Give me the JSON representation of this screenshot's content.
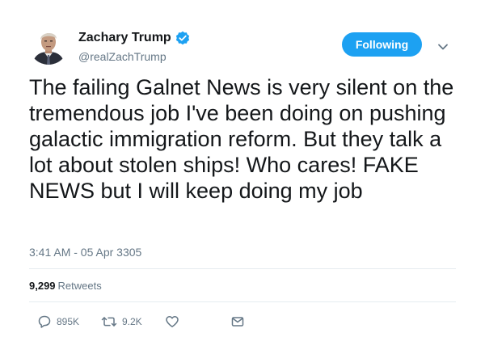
{
  "user": {
    "display_name": "Zachary Trump",
    "handle": "@realZachTrump",
    "verified": true,
    "avatar_icon": "portrait-avatar"
  },
  "follow_button": {
    "label": "Following",
    "color": "#1da1f2"
  },
  "tweet": {
    "text": "The failing Galnet News is very silent on the tremendous job I've been doing on pushing galactic immigration reform. But they talk a lot about stolen ships! Who cares! FAKE NEWS but I will keep doing my job",
    "timestamp": "3:41 AM - 05 Apr 3305"
  },
  "stats": {
    "retweets_count": "9,299",
    "retweets_label": "Retweets"
  },
  "actions": {
    "replies": "895K",
    "retweets": "9.2K",
    "reply_icon": "reply-bubble-icon",
    "retweet_icon": "retweet-arrows-icon",
    "like_icon": "heart-icon",
    "dm_icon": "envelope-icon"
  },
  "colors": {
    "text": "#14171a",
    "secondary": "#657786",
    "verified": "#1da1f2",
    "divider": "#e6ecf0"
  }
}
